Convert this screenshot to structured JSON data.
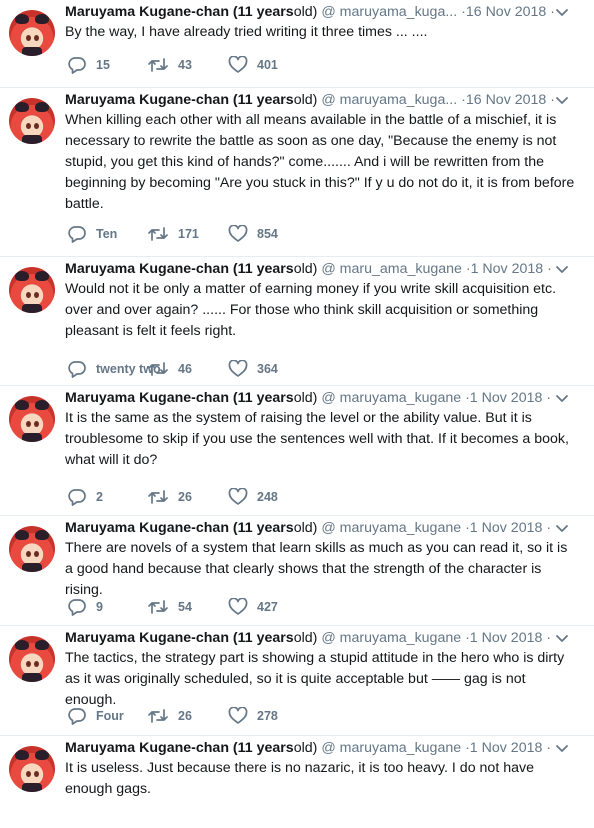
{
  "tweets": [
    {
      "name": "Maruyama Kugane-chan (11 years",
      "name_suffix": "old)",
      "handle": "@ maruyama_kuga...",
      "dot": "·",
      "date": "16 Nov 2018",
      "text": "By the way, I have already tried writing it three times ... ....",
      "replies": "15",
      "retweets": "43",
      "likes": "401"
    },
    {
      "name": "Maruyama Kugane-chan (11 years",
      "name_suffix": "old)",
      "handle": "@ maruyama_kuga...",
      "dot": "·",
      "date": "16 Nov 2018",
      "text": "When killing each other with all means available in the battle of a mischief, it is necessary to rewrite the battle as soon as one day, \"Because the enemy is not stupid, you get this kind of hands?\" come....... And i  will be rewritten from the beginning by becoming \"Are you stuck in this?\" If y  u do not do it, it is from before battle.",
      "replies": "Ten",
      "retweets": "171",
      "likes": "854"
    },
    {
      "name": "Maruyama Kugane-chan (11 years",
      "name_suffix": "old)",
      "handle": "@ maru_ama_kugane",
      "dot": "·",
      "date": "1 Nov 2018",
      "text": "Would not it be only a matter of earning money if you write skill acquisition etc. over and over again? ...... For those who think skill acquisition or something pleasant is felt it feels right.",
      "replies": "twenty two",
      "retweets": "46",
      "likes": "364"
    },
    {
      "name": "Maruyama Kugane-chan (11 years",
      "name_suffix": "old)",
      "handle": "@ maruyama_kugane",
      "dot": "·",
      "date": "1 Nov 2018",
      "text": "It is the same as the system of raising the level or the ability value. But it is troublesome to skip if you use the sentences well with that. If it becomes a book, what will it do?",
      "replies": "2",
      "retweets": "26",
      "likes": "248"
    },
    {
      "name": "Maruyama Kugane-chan (11 years",
      "name_suffix": "old)",
      "handle": "@ maruyama_kugane",
      "dot": "·",
      "date": "1 Nov 2018",
      "text": "There are novels of a system that learn skills as much as you can read it, so it is a good hand because that clearly shows that the strength of the character is rising.",
      "replies": "9",
      "retweets": "54",
      "likes": "427"
    },
    {
      "name": "Maruyama Kugane-chan (11 years",
      "name_suffix": "old)",
      "handle": "@ maruyama_kugane",
      "dot": "·",
      "date": "1 Nov 2018",
      "text": "The tactics, the strategy part is showing a stupid attitude in the hero who is dirty as it was originally scheduled, so it is quite acceptable but —— gag is not enough.",
      "replies": "Four",
      "retweets": "26",
      "likes": "278"
    },
    {
      "name": "Maruyama Kugane-chan (11 years",
      "name_suffix": "old)",
      "handle": "@ maruyama_kugane",
      "dot": "·",
      "date": "1 Nov 2018",
      "text": "It is useless. Just because there is no nazaric, it is too heavy. I do not have enough gags.",
      "replies": "",
      "retweets": "",
      "likes": ""
    }
  ],
  "icons": {
    "reply": "reply-icon",
    "retweet": "retweet-icon",
    "like": "heart-icon",
    "more": "chevron-down-icon"
  },
  "colors": {
    "text": "#14171a",
    "muted": "#657786",
    "divider": "#e6ecf0",
    "avatar_hair": "#e84a3f"
  }
}
